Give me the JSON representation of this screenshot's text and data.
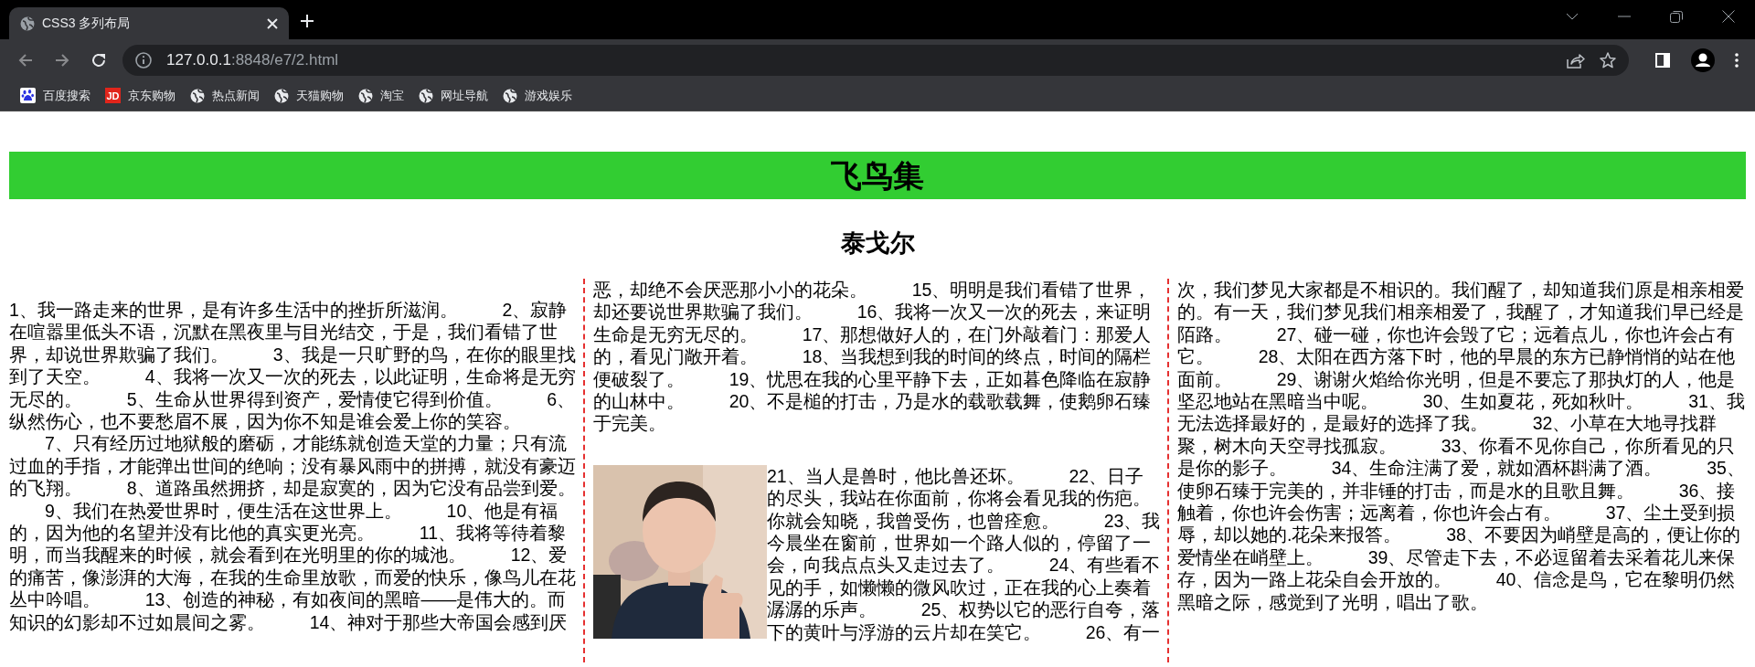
{
  "browser": {
    "tabs": [
      {
        "title": "CSS3 多列布局",
        "selected": true
      }
    ],
    "nav_buttons": [
      {
        "kind": "back",
        "disabled": true
      },
      {
        "kind": "forward",
        "disabled": true
      },
      {
        "kind": "reload",
        "disabled": false
      }
    ],
    "address": {
      "host": "127.0.0.1",
      "path": ":8848/e7/2.html"
    },
    "bookmarks": [
      {
        "label": "百度搜索",
        "kind": "paw"
      },
      {
        "label": "京东购物",
        "kind": "badge",
        "badge_text": "JD"
      },
      {
        "label": "热点新闻",
        "kind": "globe"
      },
      {
        "label": "天猫购物",
        "kind": "globe"
      },
      {
        "label": "淘宝",
        "kind": "globe"
      },
      {
        "label": "网址导航",
        "kind": "globe"
      },
      {
        "label": "游戏娱乐",
        "kind": "globe"
      }
    ]
  },
  "page": {
    "title": "飞鸟集",
    "author": "泰戈尔",
    "columns": [
      {
        "blocks": [
          {
            "indent": false,
            "figure": false,
            "items": [
              "1、我一路走来的世界，是有许多生活中的挫折所滋润。",
              "2、寂静在喧嚣里低头不语，沉默在黑夜里与目光结交，于是，我们看错了世界，却说世界欺骗了我们。",
              "3、我是一只旷野的鸟，在你的眼里找到了天空。",
              "4、我将一次又一次的死去，以此证明，生命将是无穷无尽的。",
              "5、生命从世界得到资产，爱情使它得到价值。",
              "6、纵然伤心，也不要愁眉不展，因为你不知是谁会爱上你的笑容。"
            ]
          },
          {
            "indent": true,
            "figure": false,
            "items": [
              "7、只有经历过地狱般的磨砺，才能练就创造天堂的力量；只有流过血的手指，才能弹出世间的绝响；没有暴风雨中的拼搏，就没有豪迈的飞翔。",
              "8、道路虽然拥挤，却是寂寞的，因为它没有品尝到爱。"
            ]
          },
          {
            "indent": true,
            "figure": false,
            "items": [
              "9、我们在热爱世界时，便生活在这世界上。",
              "10、他是有福的，因为他的名望并没有比他的真实更光亮。",
              "11、我将等待着黎明，而当我醒来的时候，就会看到在光明里的你的城池。",
              "12、爱的痛苦，像澎湃的大海，在我的生命里放歌，而爱的快乐，像鸟儿在花丛中吟唱。",
              "13、创造的神秘，有如夜间的黑暗——是伟大的。而知识的幻影却不过如晨间之雾。",
              "14、神对于那些大帝国会感到厌"
            ]
          }
        ]
      },
      {
        "blocks": [
          {
            "indent": false,
            "figure": false,
            "items": [
              "恶，却绝不会厌恶那小小的花朵。",
              "15、明明是我们看错了世界，却还要说世界欺骗了我们。",
              "16、我将一次又一次的死去，来证明生命是无穷无尽的。",
              "17、那想做好人的，在门外敲着门：那爱人的，看见门敞开着。",
              "18、当我想到我的时间的终点，时间的隔栏便破裂了。",
              "19、忧思在我的心里平静下去，正如暮色降临在寂静的山林中。",
              "20、不是槌的打击，乃是水的载歌载舞，使鹅卵石臻于完美。"
            ]
          },
          {
            "indent": false,
            "figure": true,
            "items": [
              "21、当人是兽时，他比兽还坏。",
              "22、日子的尽头，我站在你面前，你将会看见我的伤疤。你就会知晓，我曾受伤，也曾痊愈。",
              "23、我今晨坐在窗前，世界如一个路人似的，停留了一会，向我点点头又走过去了。",
              "24、有些看不见的手，如懒懒的微风吹过，正在我的心上奏着潺潺的乐声。",
              "25、权势以它的恶行自夸，落下的黄叶与浮游的云片却在笑它。",
              "26、有一"
            ]
          }
        ]
      },
      {
        "blocks": [
          {
            "indent": false,
            "figure": false,
            "items": [
              "次，我们梦见大家都是不相识的。我们醒了，却知道我们原是相亲相爱的。有一天，我们梦见我们相亲相爱了，我醒了，才知道我们早已经是陌路。",
              "27、碰一碰，你也许会毁了它；远着点儿，你也许会占有它。",
              "28、太阳在西方落下时，他的早晨的东方已静悄悄的站在他面前。",
              "29、谢谢火焰给你光明，但是不要忘了那执灯的人，他是坚忍地站在黑暗当中呢。",
              "30、生如夏花，死如秋叶。",
              "31、我无法选择最好的，是最好的选择了我。",
              "32、小草在大地寻找群聚，树木向天空寻找孤寂。",
              "33、你看不见你自己，你所看见的只是你的影子。",
              "34、生命注满了爱，就如酒杯斟满了酒。",
              "35、使卵石臻于完美的，并非锤的打击，而是水的且歌且舞。",
              "36、接触着，你也许会伤害；远离着，你也许会占有。",
              "37、尘土受到损辱，却以她的.花朵来报答。",
              "38、不要因为峭壁是高的，便让你的爱情坐在峭壁上。",
              "39、尽管走下去，不必逗留着去采着花儿来保存，因为一路上花朵自会开放的。",
              "40、信念是鸟，它在黎明仍然黑暗之际，感觉到了光明，唱出了歌。"
            ]
          }
        ]
      }
    ]
  }
}
